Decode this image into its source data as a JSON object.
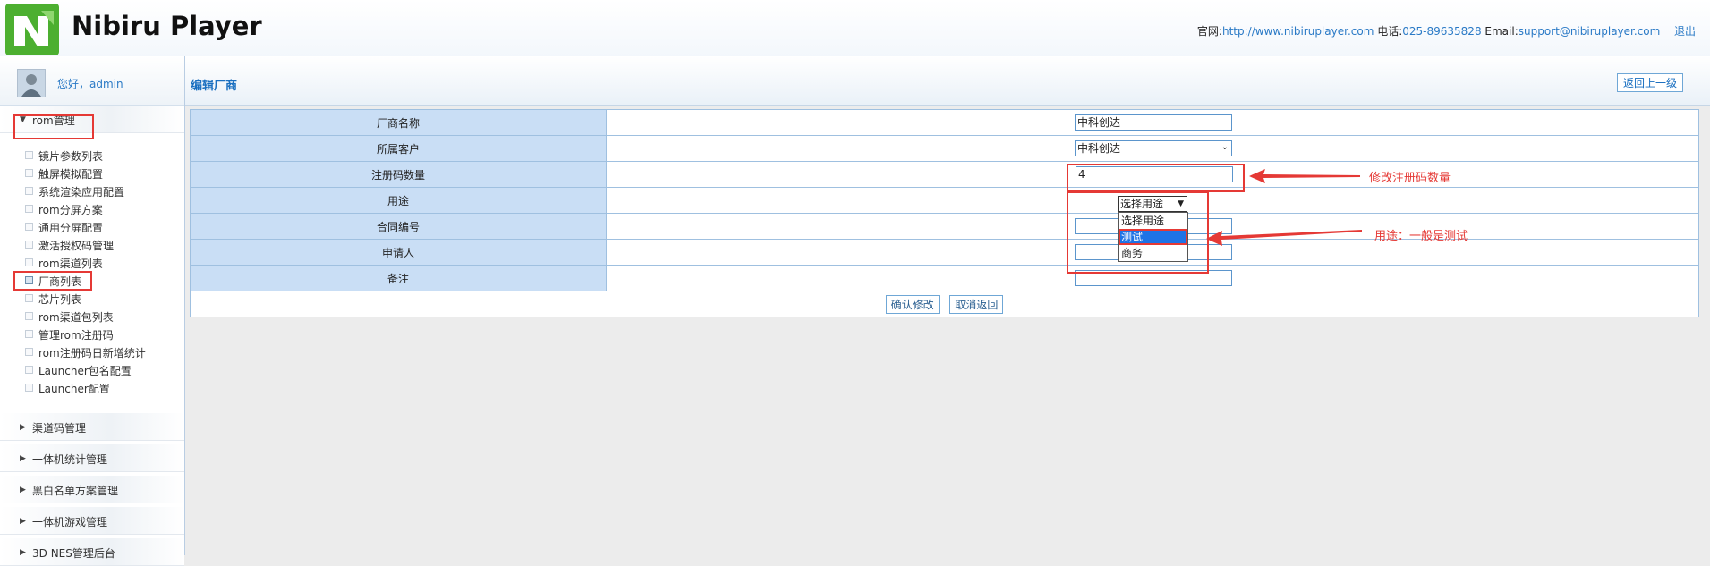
{
  "header": {
    "brand": "Nibiru Player",
    "site_label": "官网:",
    "site_url": "http://www.nibiruplayer.com",
    "phone_label": "电话:",
    "phone": "025-89635828",
    "email_label": "Email:",
    "email": "support@nibiruplayer.com",
    "logout": "退出"
  },
  "user": {
    "greeting": "您好，admin"
  },
  "sidebar": {
    "groups": [
      {
        "label": "rom管理",
        "expanded": true
      },
      {
        "label": "渠道码管理",
        "expanded": false
      },
      {
        "label": "一体机统计管理",
        "expanded": false
      },
      {
        "label": "黑白名单方案管理",
        "expanded": false
      },
      {
        "label": "一体机游戏管理",
        "expanded": false
      },
      {
        "label": "3D NES管理后台",
        "expanded": false
      }
    ],
    "rom_items": [
      "镜片参数列表",
      "触屏模拟配置",
      "系统渲染应用配置",
      "rom分屏方案",
      "通用分屏配置",
      "激活授权码管理",
      "rom渠道列表",
      "厂商列表",
      "芯片列表",
      "rom渠道包列表",
      "管理rom注册码",
      "rom注册码日新增统计",
      "Launcher包名配置",
      "Launcher配置"
    ],
    "active_item": "厂商列表"
  },
  "main": {
    "title": "编辑厂商",
    "back_button": "返回上一级",
    "fields": {
      "vendor_name": {
        "label": "厂商名称",
        "value": "中科创达"
      },
      "customer": {
        "label": "所属客户",
        "value": "中科创达"
      },
      "reg_count": {
        "label": "注册码数量",
        "value": "4"
      },
      "purpose": {
        "label": "用途",
        "value": "选择用途",
        "options": [
          "选择用途",
          "测试",
          "商务"
        ],
        "highlighted": "测试"
      },
      "contract_no": {
        "label": "合同编号",
        "value": ""
      },
      "applicant": {
        "label": "申请人",
        "value": ""
      },
      "remark": {
        "label": "备注",
        "value": ""
      }
    },
    "confirm_button": "确认修改",
    "cancel_button": "取消返回"
  },
  "annotations": {
    "reg_count_note": "修改注册码数量",
    "purpose_note": "用途：一般是测试"
  },
  "colors": {
    "annotation": "#e53935",
    "label_cell": "#c9def5",
    "link": "#2a7ac6",
    "title": "#1a6fc0"
  }
}
